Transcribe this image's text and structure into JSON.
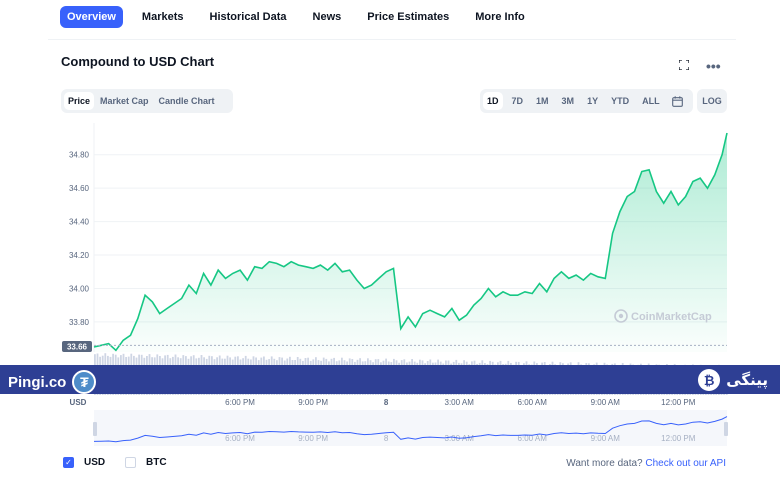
{
  "nav": {
    "items": [
      "Overview",
      "Markets",
      "Historical Data",
      "News",
      "Price Estimates",
      "More Info"
    ],
    "active_index": 0
  },
  "chart_title": "Compound to USD Chart",
  "icons": {
    "fullscreen": "fullscreen-icon",
    "more": "more-icon",
    "calendar": "calendar-icon"
  },
  "chart_type_tabs": [
    "Price",
    "Market Cap",
    "Candle Chart"
  ],
  "range_tabs": [
    "1D",
    "7D",
    "1M",
    "3M",
    "1Y",
    "YTD",
    "ALL"
  ],
  "log_label": "LOG",
  "watermark": "CoinMarketCap",
  "banner": {
    "left_text": "Pingi.co",
    "right_text": "پینگی",
    "color": "#2e3f94"
  },
  "colors": {
    "accent": "#3861fb",
    "line": "#16c784",
    "fill": "#16c784",
    "down": "#ea3943"
  },
  "chart_data": {
    "type": "line",
    "y_ticks": [
      "34.80",
      "34.60",
      "34.40",
      "34.20",
      "34.00",
      "33.80"
    ],
    "y_tick_values": [
      34.8,
      34.6,
      34.4,
      34.2,
      34.0,
      33.8
    ],
    "ylim": [
      33.62,
      34.96
    ],
    "baseline_label": "33.66",
    "baseline_value": 33.66,
    "x_currency_label": "USD",
    "x_ticks": [
      "6:00 PM",
      "9:00 PM",
      "8",
      "3:00 AM",
      "6:00 AM",
      "9:00 AM",
      "12:00 PM"
    ],
    "x_tick_hours": [
      6,
      9,
      12,
      15,
      18,
      21,
      24
    ],
    "x_range_hours": [
      0,
      26
    ],
    "series": [
      {
        "x": [
          0,
          0.3,
          0.6,
          0.9,
          1.2,
          1.5,
          1.8,
          2.1,
          2.4,
          2.7,
          3.0,
          3.3,
          3.6,
          3.9,
          4.2,
          4.5,
          4.8,
          5.1,
          5.4,
          5.7,
          6.0,
          6.3,
          6.6,
          6.9,
          7.2,
          7.5,
          7.8,
          8.1,
          8.4,
          8.7,
          9.0,
          9.3,
          9.6,
          9.9,
          10.2,
          10.5,
          10.8,
          11.1,
          11.4,
          11.7,
          12.0,
          12.3,
          12.6,
          12.9,
          13.2,
          13.5,
          13.8,
          14.1,
          14.4,
          14.7,
          15.0,
          15.3,
          15.6,
          15.9,
          16.2,
          16.5,
          16.8,
          17.1,
          17.4,
          17.7,
          18.0,
          18.3,
          18.6,
          18.9,
          19.2,
          19.5,
          19.8,
          20.1,
          20.4,
          20.7,
          21.0,
          21.3,
          21.6,
          21.9,
          22.2,
          22.5,
          22.8,
          23.1,
          23.4,
          23.7,
          24.0,
          24.3,
          24.6,
          24.9,
          25.2,
          25.5,
          25.8,
          26.0
        ],
        "y": [
          33.65,
          33.66,
          33.67,
          33.63,
          33.69,
          33.72,
          33.82,
          33.96,
          33.92,
          33.85,
          33.88,
          33.91,
          33.94,
          34.02,
          33.97,
          34.09,
          34.02,
          34.11,
          34.06,
          34.09,
          34.11,
          34.05,
          34.13,
          34.12,
          34.16,
          34.15,
          34.13,
          34.16,
          34.14,
          34.13,
          34.12,
          34.14,
          34.11,
          34.15,
          34.1,
          34.11,
          34.05,
          34.0,
          34.02,
          34.06,
          34.1,
          34.12,
          33.76,
          33.83,
          33.77,
          33.85,
          33.87,
          33.85,
          33.83,
          33.88,
          33.81,
          33.84,
          33.9,
          33.94,
          34.0,
          33.95,
          33.98,
          33.96,
          33.96,
          33.98,
          33.97,
          34.03,
          33.98,
          34.06,
          34.1,
          34.06,
          34.08,
          34.05,
          34.09,
          34.07,
          34.06,
          34.33,
          34.46,
          34.55,
          34.58,
          34.7,
          34.71,
          34.58,
          34.51,
          34.58,
          34.5,
          34.55,
          34.64,
          34.66,
          34.6,
          34.68,
          34.8,
          34.93
        ]
      }
    ]
  },
  "currency": {
    "options": [
      {
        "label": "USD",
        "checked": true
      },
      {
        "label": "BTC",
        "checked": false
      }
    ],
    "api_text": "Want more data? ",
    "api_link": "Check out our API"
  }
}
